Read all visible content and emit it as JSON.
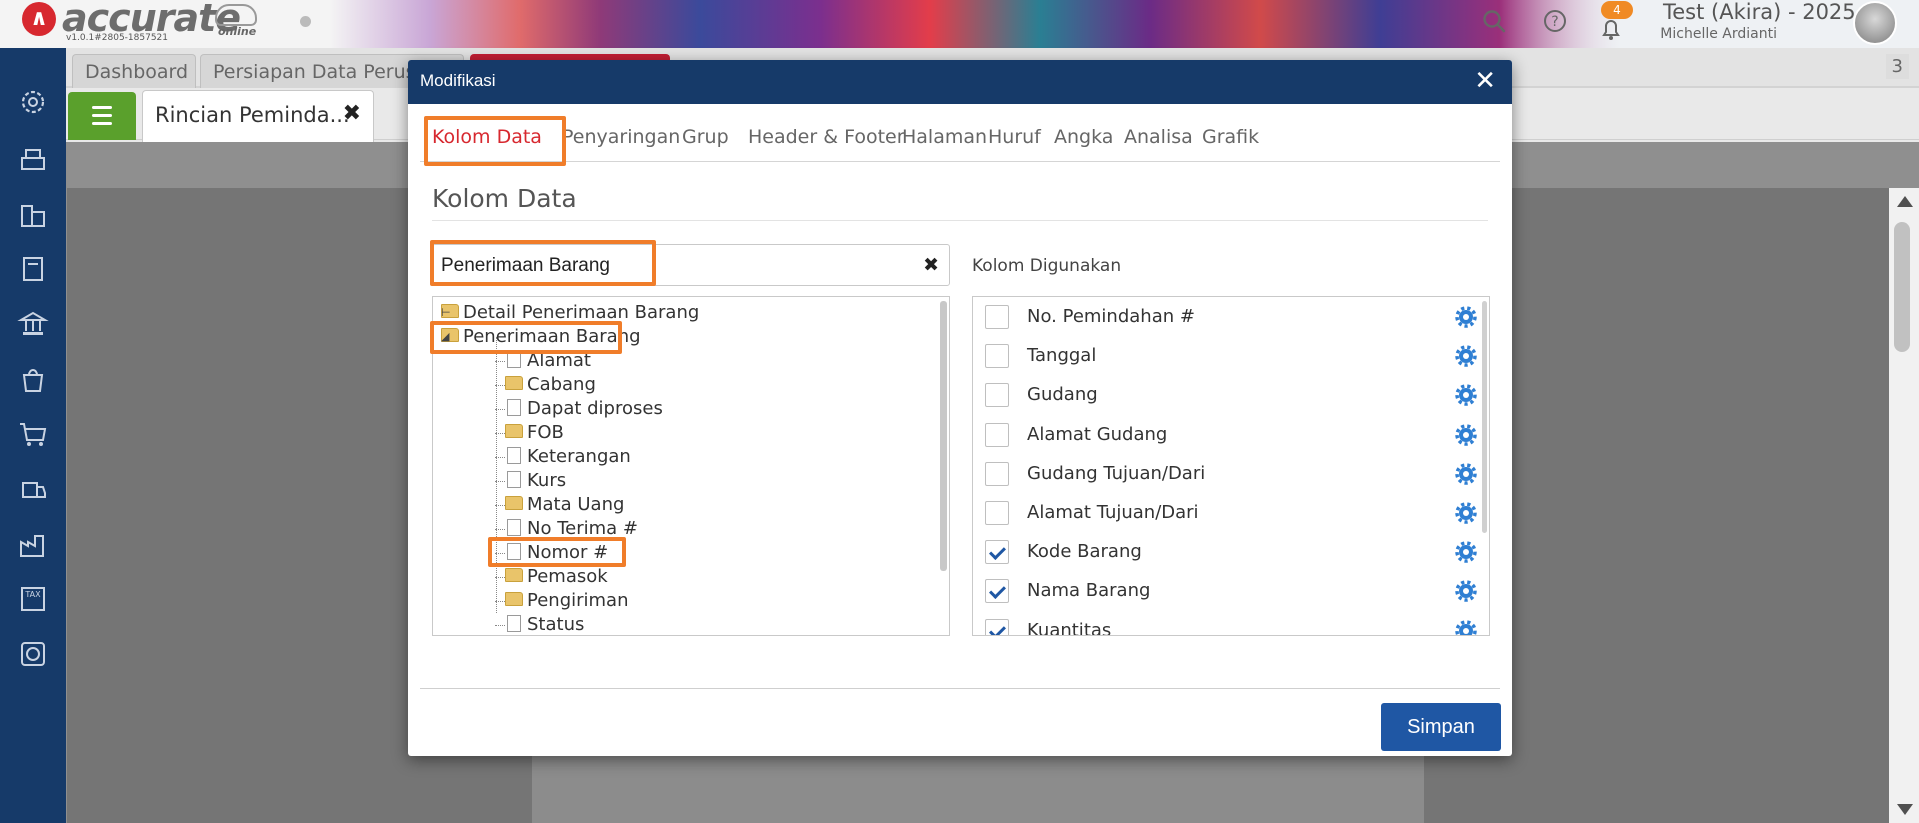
{
  "app": {
    "logo_text": "accurate",
    "logo_sub": "online",
    "version": "v1.0.1#2805-1857521",
    "notification_count": "4",
    "user_title": "Test (Akira) - 2025",
    "user_name": "Michelle Ardianti",
    "sidebar_icons": [
      "gear-icon",
      "cash-register-icon",
      "buildings-icon",
      "book-icon",
      "bank-icon",
      "bag-icon",
      "cart-icon",
      "delivery-icon",
      "factory-icon",
      "tax-icon",
      "report-chart-icon"
    ]
  },
  "workspace": {
    "tabs": [
      "Dashboard",
      "Persiapan Data Perusa",
      ""
    ],
    "tab_count": "3",
    "report_tab_label": "Rincian Peminda..."
  },
  "modal": {
    "title": "Modifikasi",
    "close_glyph": "✕",
    "tabs": [
      "Kolom Data",
      "Penyaringan",
      "Grup",
      "Header & Footer",
      "Halaman",
      "Huruf",
      "Angka",
      "Analisa",
      "Grafik"
    ],
    "active_tab": "Kolom Data",
    "section_title": "Kolom Data",
    "search": {
      "value": "Penerimaan Barang",
      "clear_glyph": "✖"
    },
    "tree": {
      "root1": "Detail Penerimaan Barang",
      "root2": "Penerimaan Barang",
      "children": [
        {
          "label": "Alamat",
          "type": "doc"
        },
        {
          "label": "Cabang",
          "type": "folder"
        },
        {
          "label": "Dapat diproses",
          "type": "doc"
        },
        {
          "label": "FOB",
          "type": "folder"
        },
        {
          "label": "Keterangan",
          "type": "doc"
        },
        {
          "label": "Kurs",
          "type": "doc"
        },
        {
          "label": "Mata Uang",
          "type": "folder"
        },
        {
          "label": "No Terima #",
          "type": "doc"
        },
        {
          "label": "Nomor #",
          "type": "doc"
        },
        {
          "label": "Pemasok",
          "type": "folder"
        },
        {
          "label": "Pengiriman",
          "type": "folder"
        },
        {
          "label": "Status",
          "type": "doc"
        }
      ]
    },
    "used_title": "Kolom Digunakan",
    "used_columns": [
      {
        "label": "No. Pemindahan #",
        "checked": false
      },
      {
        "label": "Tanggal",
        "checked": false
      },
      {
        "label": "Gudang",
        "checked": false
      },
      {
        "label": "Alamat Gudang",
        "checked": false
      },
      {
        "label": "Gudang Tujuan/Dari",
        "checked": false
      },
      {
        "label": "Alamat Tujuan/Dari",
        "checked": false
      },
      {
        "label": "Kode Barang",
        "checked": true
      },
      {
        "label": "Nama Barang",
        "checked": true
      },
      {
        "label": "Kuantitas",
        "checked": true
      }
    ],
    "save_label": "Simpan",
    "colors": {
      "header": "#163a69",
      "active_tab": "#d7282f",
      "highlight": "#f07d2a",
      "save": "#1f57a4",
      "gear": "#2f7fd3"
    }
  }
}
